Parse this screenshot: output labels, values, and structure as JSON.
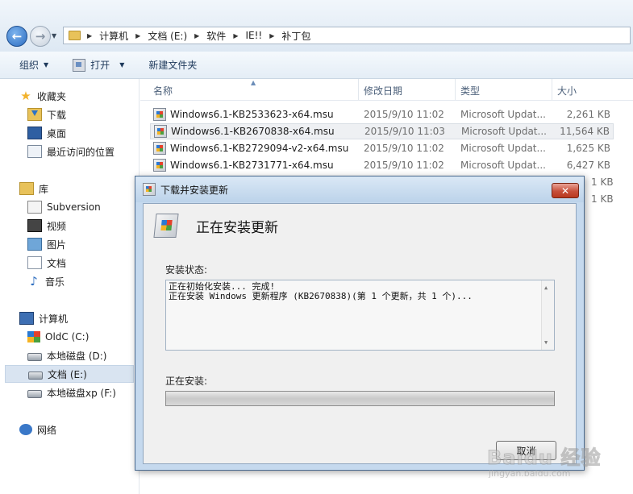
{
  "address": {
    "breadcrumbs": [
      "计算机",
      "文档 (E:)",
      "软件",
      "IE!!",
      "补丁包"
    ]
  },
  "toolbar": {
    "organize": "组织",
    "open": "打开",
    "new_folder": "新建文件夹"
  },
  "navpane": {
    "favorites": "收藏夹",
    "downloads": "下载",
    "desktop": "桌面",
    "recent": "最近访问的位置",
    "libraries": "库",
    "subversion": "Subversion",
    "videos": "视频",
    "pictures": "图片",
    "documents": "文档",
    "music": "音乐",
    "computer": "计算机",
    "drive_c": "OldC (C:)",
    "drive_d": "本地磁盘 (D:)",
    "drive_e": "文档 (E:)",
    "drive_f": "本地磁盘xp (F:)",
    "network": "网络"
  },
  "filelist": {
    "headers": {
      "name": "名称",
      "date": "修改日期",
      "type": "类型",
      "size": "大小"
    },
    "rows": [
      {
        "name": "Windows6.1-KB2533623-x64.msu",
        "date": "2015/9/10 11:02",
        "type": "Microsoft Updat...",
        "size": "2,261 KB"
      },
      {
        "name": "Windows6.1-KB2670838-x64.msu",
        "date": "2015/9/10 11:03",
        "type": "Microsoft Updat...",
        "size": "11,564 KB"
      },
      {
        "name": "Windows6.1-KB2729094-v2-x64.msu",
        "date": "2015/9/10 11:02",
        "type": "Microsoft Updat...",
        "size": "1,625 KB"
      },
      {
        "name": "Windows6.1-KB2731771-x64.msu",
        "date": "2015/9/10 11:02",
        "type": "Microsoft Updat...",
        "size": "6,427 KB"
      }
    ],
    "partial_sizes": [
      "1 KB",
      "1 KB"
    ]
  },
  "dialog": {
    "title": "下载并安装更新",
    "close": "✕",
    "heading": "正在安装更新",
    "status_label": "安装状态:",
    "status_line1": "正在初始化安装... 完成!",
    "status_line2": "正在安装 Windows 更新程序 (KB2670838)(第 1 个更新，共 1 个)...",
    "installing_label": "正在安装:",
    "cancel": "取消"
  },
  "watermark": {
    "main": "Baidu 经验",
    "sub": "jingyan.baidu.com"
  }
}
